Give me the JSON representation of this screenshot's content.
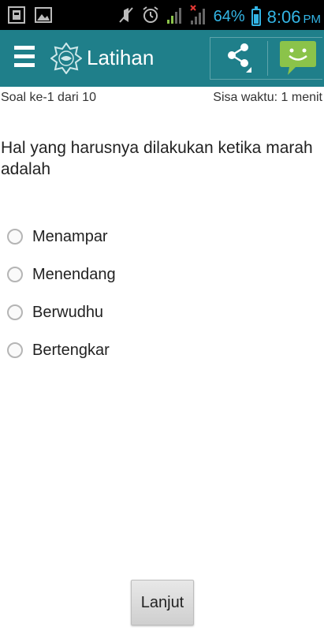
{
  "status_bar": {
    "battery_percent": "64%",
    "battery_level": 0.64,
    "time": "8:06",
    "ampm": "PM",
    "icons": [
      "notification-icon",
      "image-icon",
      "mute-icon",
      "alarm-icon",
      "signal-icon",
      "no-signal-icon",
      "battery-icon"
    ]
  },
  "app_bar": {
    "title": "Latihan",
    "icons": [
      "menu-icon",
      "app-logo-icon",
      "share-icon",
      "feedback-smiley-icon"
    ],
    "color": "#1f7f8a"
  },
  "quiz": {
    "progress_text": "Soal ke-1 dari 10",
    "timer_text": "Sisa waktu: 1 menit",
    "question": "Hal yang harusnya dilakukan ketika marah adalah",
    "options": [
      {
        "label": "Menampar"
      },
      {
        "label": "Menendang"
      },
      {
        "label": "Berwudhu"
      },
      {
        "label": "Bertengkar"
      }
    ],
    "next_label": "Lanjut"
  }
}
